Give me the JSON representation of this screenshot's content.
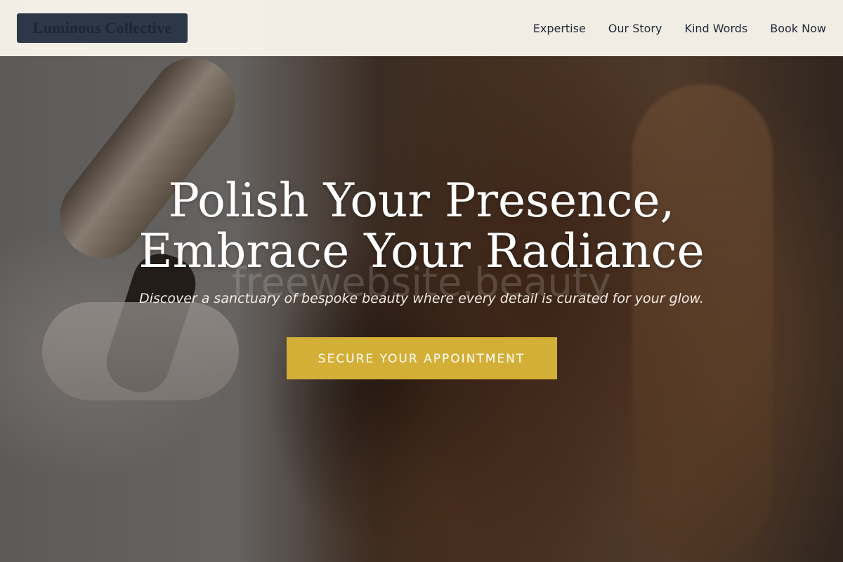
{
  "brand": {
    "name": "Luminous Collective"
  },
  "nav": {
    "items": [
      {
        "label": "Expertise"
      },
      {
        "label": "Our Story"
      },
      {
        "label": "Kind Words"
      },
      {
        "label": "Book Now"
      }
    ]
  },
  "hero": {
    "headline_line1": "Polish Your Presence,",
    "headline_line2": "Embrace Your Radiance",
    "subtitle": "Discover a sanctuary of bespoke beauty where every detail is curated for your glow.",
    "cta_label": "SECURE YOUR APPOINTMENT",
    "watermark": "freewebsite.beauty",
    "background_image": "stylist-curling-hair-photo"
  },
  "colors": {
    "header_bg": "#f9f5ec",
    "logo_bg": "#2c3748",
    "accent_gold": "#d4af37",
    "nav_text": "#1f2937",
    "headline_text": "#ffffff"
  }
}
